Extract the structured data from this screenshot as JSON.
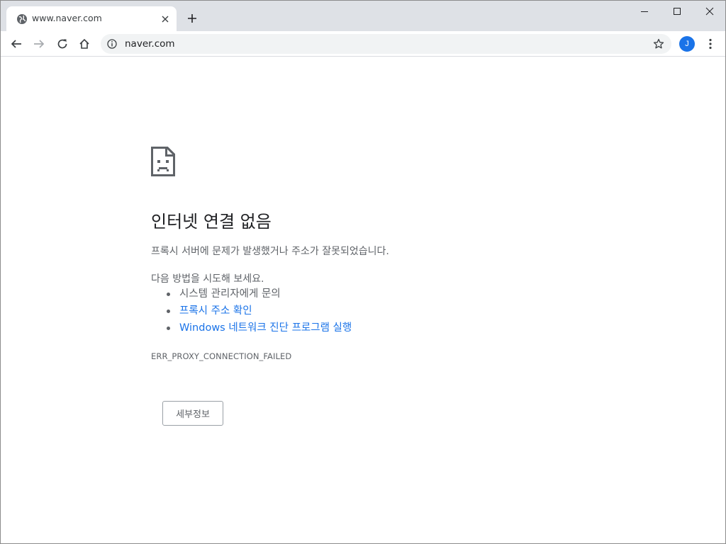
{
  "browser": {
    "tab": {
      "title": "www.naver.com",
      "favicon": "globe-icon"
    },
    "omnibox": {
      "url": "naver.com"
    },
    "profile": {
      "initial": "J",
      "color": "#1a73e8"
    }
  },
  "error_page": {
    "icon": "sad-page-icon",
    "heading": "인터넷 연결 없음",
    "description": "프록시 서버에 문제가 발생했거나 주소가 잘못되었습니다.",
    "suggestions_intro": "다음 방법을 시도해 보세요.",
    "suggestions": [
      {
        "label": "시스템 관리자에게 문의",
        "is_link": false
      },
      {
        "label": "프록시 주소 확인",
        "is_link": true
      },
      {
        "label": "Windows 네트워크 진단 프로그램 실행",
        "is_link": true
      }
    ],
    "error_code": "ERR_PROXY_CONNECTION_FAILED",
    "details_button": "세부정보"
  },
  "colors": {
    "link": "#1a73e8",
    "text_secondary": "#5f6368",
    "tabstrip": "#dee1e6"
  }
}
